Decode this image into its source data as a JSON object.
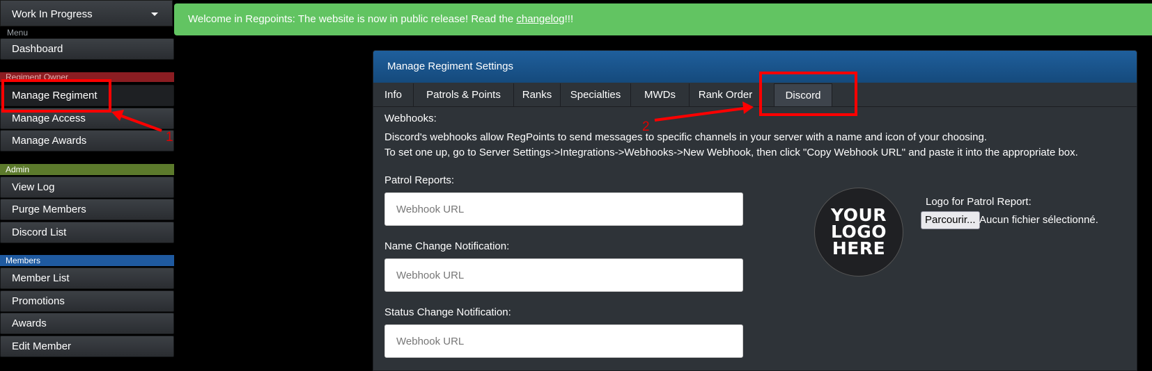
{
  "sidebar": {
    "regiment_select": "Work In Progress",
    "sections": {
      "menu": "Menu",
      "owner": "Regiment Owner",
      "admin": "Admin",
      "members": "Members"
    },
    "items": {
      "dashboard": "Dashboard",
      "manage_regiment": "Manage Regiment",
      "manage_access": "Manage Access",
      "manage_awards": "Manage Awards",
      "view_log": "View Log",
      "purge_members": "Purge Members",
      "discord_list": "Discord List",
      "member_list": "Member List",
      "promotions": "Promotions",
      "awards": "Awards",
      "edit_member": "Edit Member"
    }
  },
  "banner": {
    "text_before": "Welcome in Regpoints: The website is now in public release! Read the ",
    "link": "changelog",
    "text_after": "!!!"
  },
  "panel": {
    "title": "Manage Regiment Settings",
    "tabs": {
      "info": "Info",
      "patrols": "Patrols & Points",
      "ranks": "Ranks",
      "specialties": "Specialties",
      "mwds": "MWDs",
      "rank_order": "Rank Order",
      "discord": "Discord"
    },
    "webhooks_label": "Webhooks:",
    "desc1": "Discord's webhooks allow RegPoints to send messages to specific channels in your server with a name and icon of your choosing.",
    "desc2": "To set one up, go to Server Settings->Integrations->Webhooks->New Webhook, then click \"Copy Webhook URL\" and paste it into the appropriate box.",
    "patrol_label": "Patrol Reports:",
    "name_change_label": "Name Change Notification:",
    "status_change_label": "Status Change Notification:",
    "webhook_placeholder": "Webhook URL",
    "logo_lines": [
      "YOUR",
      "LOGO",
      "HERE"
    ],
    "logo_label": "Logo for Patrol Report:",
    "file_button": "Parcourir...",
    "file_status": "Aucun fichier sélectionné."
  },
  "annotations": {
    "one": "1",
    "two": "2",
    "color": "#ff0000"
  },
  "icons": {
    "select_caret": "caret-down-icon"
  },
  "colors": {
    "banner": "#62c462",
    "panel_heading": "#1f5f9c",
    "owner_section": "#8b1d22",
    "admin_section": "#5c7a2c",
    "members_section": "#1f5aa0"
  }
}
